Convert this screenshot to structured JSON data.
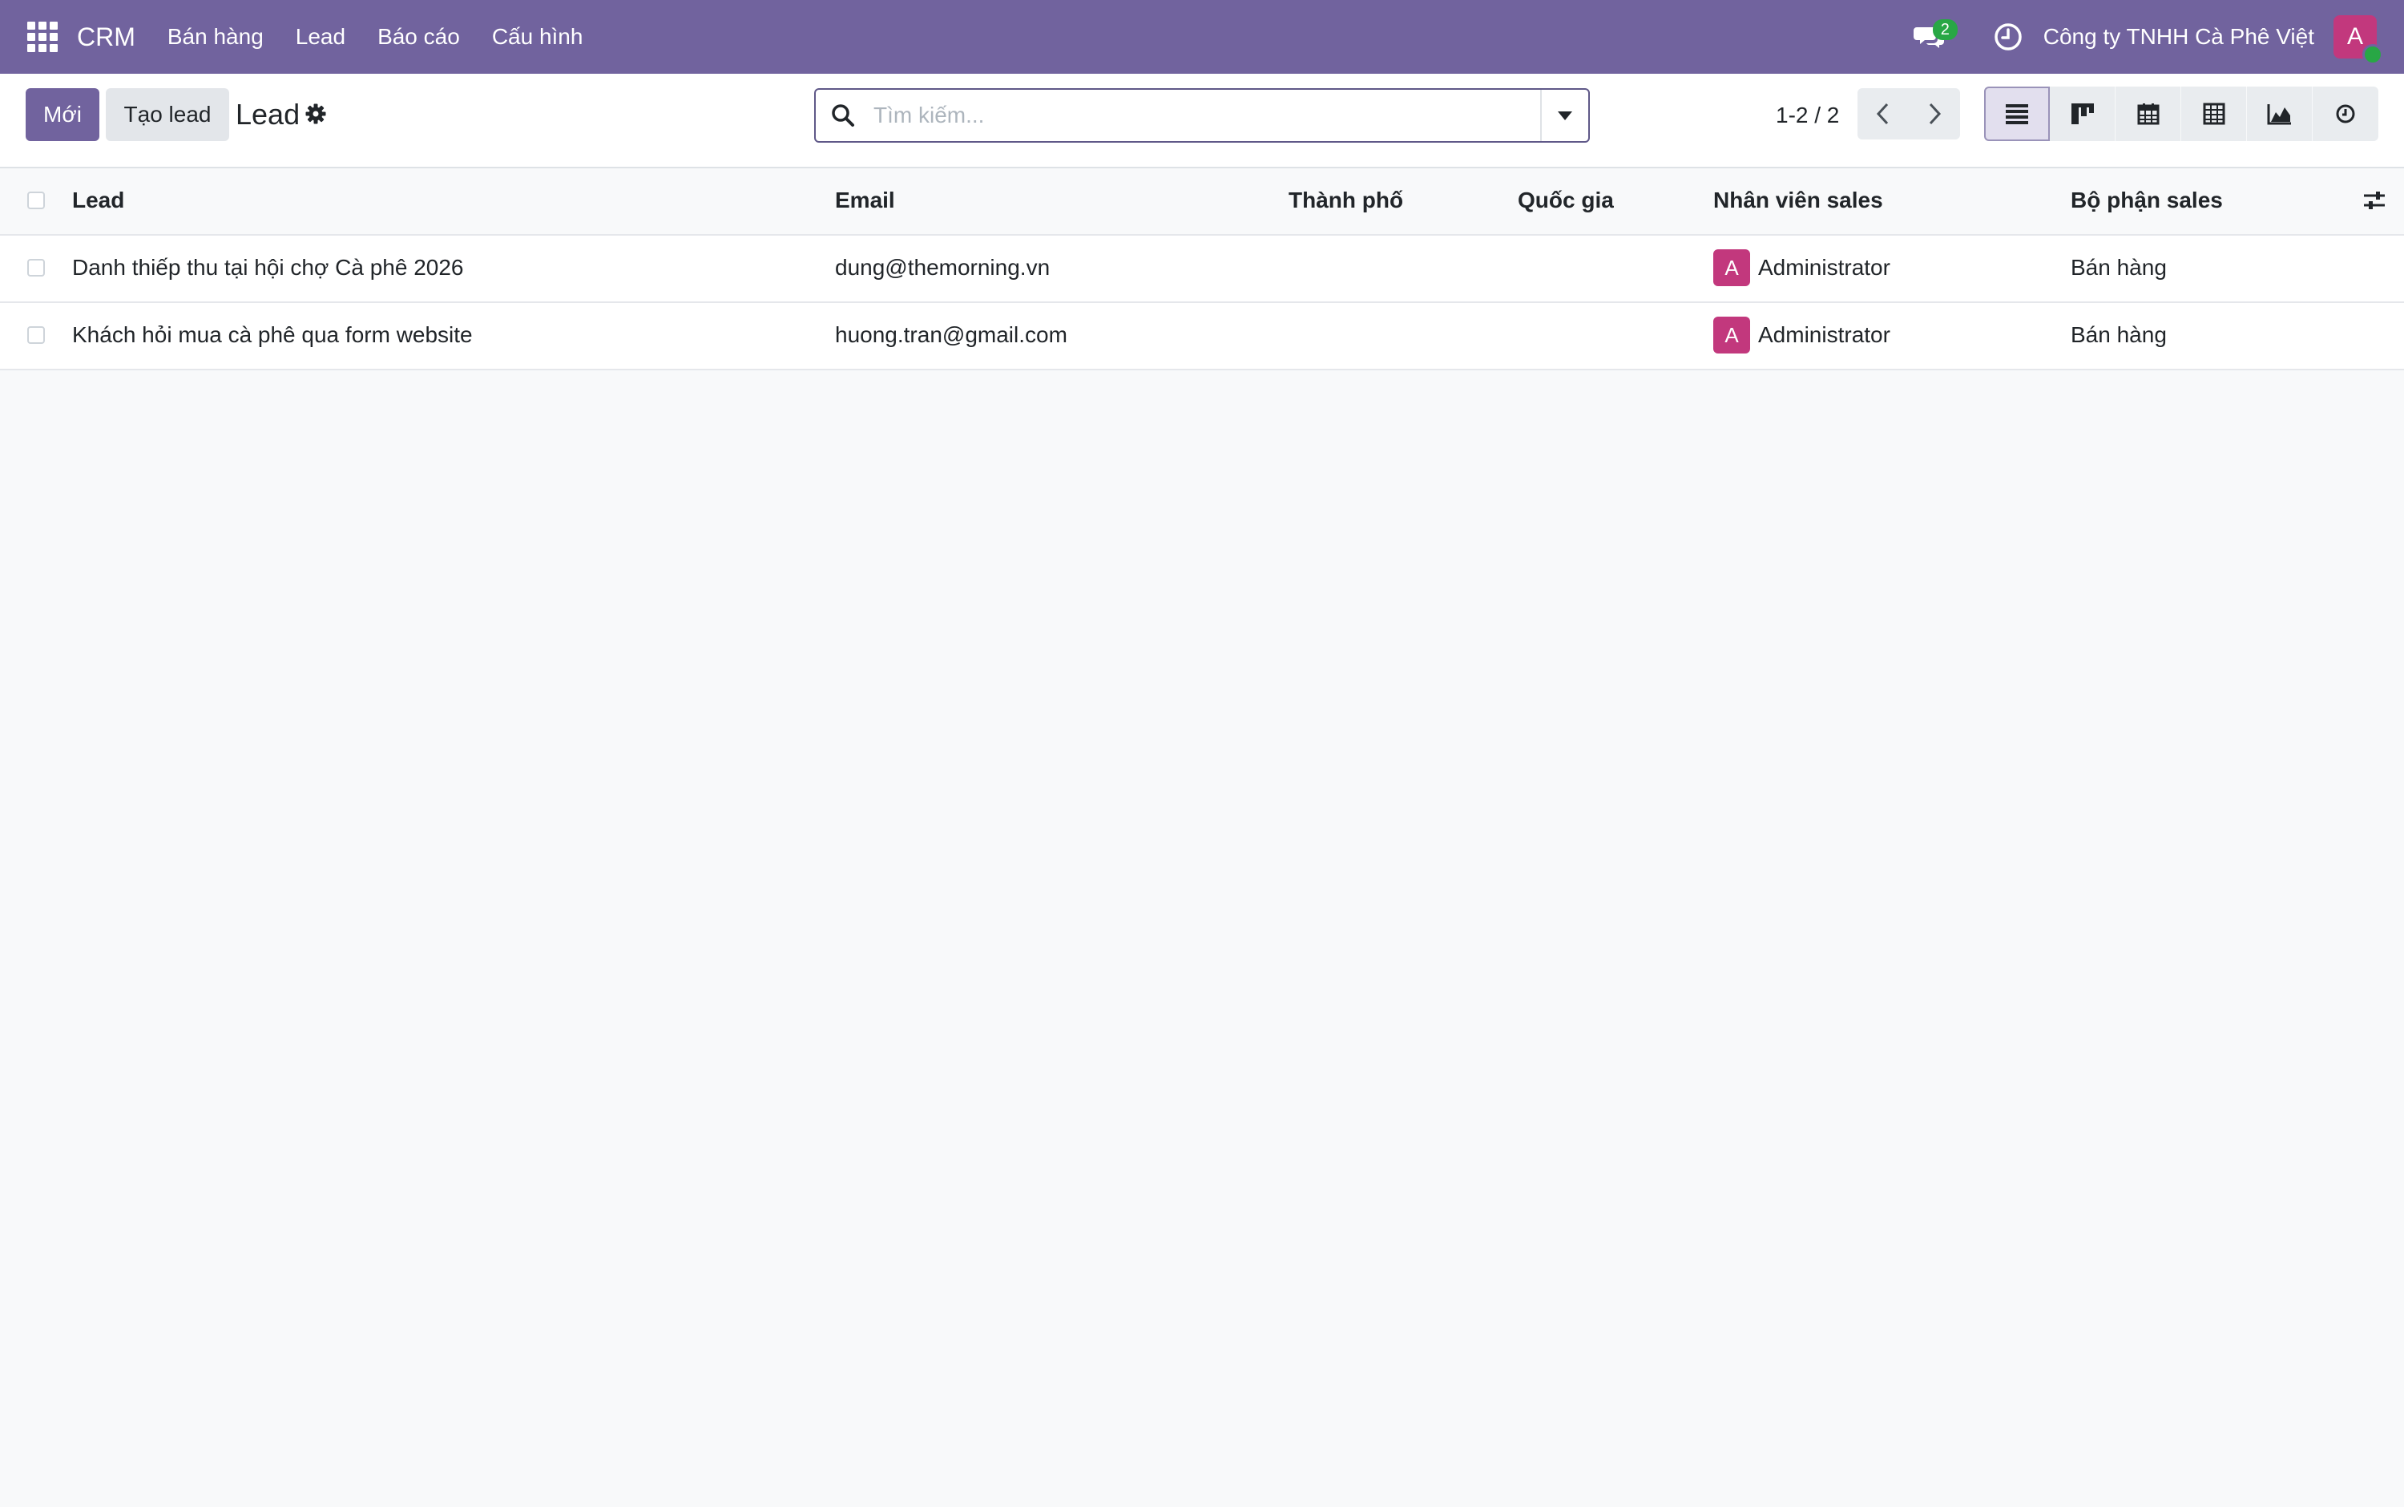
{
  "navbar": {
    "brand": "CRM",
    "menu": [
      "Bán hàng",
      "Lead",
      "Báo cáo",
      "Cấu hình"
    ],
    "chat_badge": "2",
    "company": "Công ty TNHH Cà Phê Việt",
    "avatar_initial": "A"
  },
  "control": {
    "new_label": "Mới",
    "create_lead_label": "Tạo lead",
    "breadcrumb": "Lead",
    "search_placeholder": "Tìm kiếm...",
    "pager": "1-2 / 2"
  },
  "table": {
    "columns": {
      "lead": "Lead",
      "email": "Email",
      "city": "Thành phố",
      "country": "Quốc gia",
      "salesperson": "Nhân viên sales",
      "team": "Bộ phận sales"
    },
    "rows": [
      {
        "lead": "Danh thiếp thu tại hội chợ Cà phê 2026",
        "email": "dung@themorning.vn",
        "city": "",
        "country": "",
        "salesperson_initial": "A",
        "salesperson": "Administrator",
        "team": "Bán hàng"
      },
      {
        "lead": "Khách hỏi mua cà phê qua form website",
        "email": "huong.tran@gmail.com",
        "city": "",
        "country": "",
        "salesperson_initial": "A",
        "salesperson": "Administrator",
        "team": "Bán hàng"
      }
    ]
  },
  "colors": {
    "navbar": "#71639e",
    "primary": "#71639e",
    "avatar": "#c2387d",
    "badge": "#28a745"
  },
  "icons": [
    "apps-grid-icon",
    "chat-icon",
    "clock-icon",
    "gear-icon",
    "search-icon",
    "list-view-icon",
    "kanban-view-icon",
    "calendar-view-icon",
    "pivot-view-icon",
    "graph-view-icon",
    "activity-view-icon",
    "optional-columns-icon"
  ]
}
